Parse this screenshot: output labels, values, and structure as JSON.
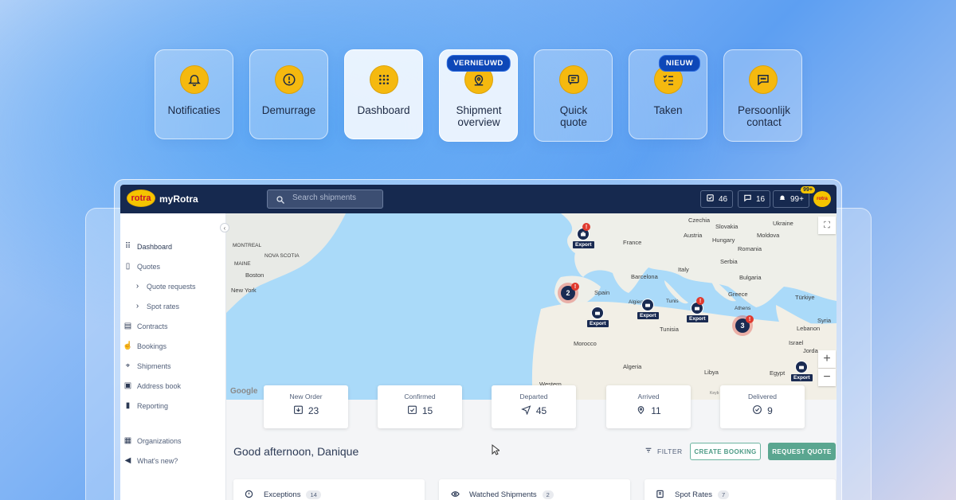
{
  "features": [
    {
      "label": "Notificaties",
      "icon": "bell-icon",
      "badge": ""
    },
    {
      "label": "Demurrage",
      "icon": "alert-circle-icon",
      "badge": ""
    },
    {
      "label": "Dashboard",
      "icon": "grid-icon",
      "badge": ""
    },
    {
      "label": "Shipment overview",
      "icon": "location-pin-icon",
      "badge": "VERNIEUWD"
    },
    {
      "label": "Quick quote",
      "icon": "quote-icon",
      "badge": ""
    },
    {
      "label": "Taken",
      "icon": "checklist-icon",
      "badge": "NIEUW"
    },
    {
      "label": "Persoonlijk contact",
      "icon": "chat-icon",
      "badge": ""
    }
  ],
  "app": {
    "logo": "rotra",
    "brand": "myRotra",
    "search_placeholder": "Search shipments",
    "tasks_count": "46",
    "messages_count": "16",
    "notifications_count": "99+",
    "notifications_badge": "99+",
    "avatar": "rotra"
  },
  "sidebar": {
    "items": [
      {
        "label": "Dashboard",
        "icon": "grid-icon"
      },
      {
        "label": "Quotes",
        "icon": "quote-doc-icon"
      },
      {
        "label": "Quote requests",
        "icon": "chevron-right-icon"
      },
      {
        "label": "Spot rates",
        "icon": "chevron-right-icon"
      },
      {
        "label": "Contracts",
        "icon": "contract-icon"
      },
      {
        "label": "Bookings",
        "icon": "hand-pointer-icon"
      },
      {
        "label": "Shipments",
        "icon": "route-icon"
      },
      {
        "label": "Address book",
        "icon": "address-book-icon"
      },
      {
        "label": "Reporting",
        "icon": "bar-chart-icon"
      },
      {
        "label": "Organizations",
        "icon": "building-icon"
      },
      {
        "label": "What's new?",
        "icon": "megaphone-icon"
      }
    ]
  },
  "map": {
    "labels": [
      "Czechia",
      "Ukraine",
      "Slovakia",
      "France",
      "Austria",
      "Moldova",
      "Hungary",
      "Romania",
      "Serbia",
      "MONTREAL",
      "Italy",
      "Bulgaria",
      "NOVA SCOTIA",
      "MAINE",
      "Boston",
      "Barcelona",
      "Greece",
      "Türkiye",
      "New York",
      "Spain",
      "Algiers",
      "Tunis",
      "Athens",
      "Tunisia",
      "Syria",
      "Lebanon",
      "Morocco",
      "Israel",
      "Jorda",
      "Algeria",
      "Libya",
      "Egypt",
      "Western"
    ],
    "export_label": "Export",
    "cluster_1": "2",
    "cluster_2": "3",
    "google": "Google",
    "keyboard": "Keyb"
  },
  "stats": [
    {
      "label": "New Order",
      "value": "23",
      "icon": "download-box-icon"
    },
    {
      "label": "Confirmed",
      "value": "15",
      "icon": "check-box-icon"
    },
    {
      "label": "Departed",
      "value": "45",
      "icon": "send-icon"
    },
    {
      "label": "Arrived",
      "value": "11",
      "icon": "map-pin-icon"
    },
    {
      "label": "Delivered",
      "value": "9",
      "icon": "check-circle-icon"
    }
  ],
  "greeting": "Good afternoon, Danique",
  "filter_label": "FILTER",
  "create_booking": "CREATE BOOKING",
  "request_quote": "REQUEST QUOTE",
  "panels": [
    {
      "title": "Exceptions",
      "count": "14",
      "icon": "info-icon"
    },
    {
      "title": "Watched Shipments",
      "count": "2",
      "icon": "eye-icon"
    },
    {
      "title": "Spot Rates",
      "count": "7",
      "icon": "spot-rate-icon"
    }
  ]
}
